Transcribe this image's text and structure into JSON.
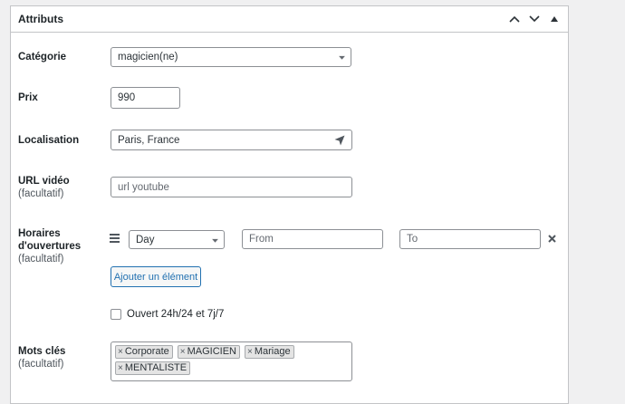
{
  "panel": {
    "title": "Attributs",
    "controls": [
      "move-up",
      "move-down",
      "toggle"
    ]
  },
  "categorie": {
    "label": "Catégorie",
    "value": "magicien(ne)"
  },
  "prix": {
    "label": "Prix",
    "value": "990"
  },
  "localisation": {
    "label": "Localisation",
    "value": "Paris, France",
    "icon": "location-arrow-icon"
  },
  "url_video": {
    "label": "URL vidéo",
    "sublabel": "(facultatif)",
    "placeholder": "url youtube"
  },
  "horaires": {
    "label_line1": "Horaires",
    "label_line2": "d'ouvertures",
    "sublabel": "(facultatif)",
    "day_value": "Day",
    "from_placeholder": "From",
    "to_placeholder": "To",
    "add_button": "Ajouter un élément",
    "open_247_label": "Ouvert 24h/24 et 7j/7",
    "open_247_checked": false
  },
  "mots_cles": {
    "label": "Mots clés",
    "sublabel": "(facultatif)",
    "tags": [
      "Corporate",
      "MAGICIEN",
      "Mariage",
      "MENTALISTE"
    ]
  },
  "colors": {
    "accent": "#2271b1",
    "border": "#c3c4c7",
    "background": "#f0f0f1"
  }
}
